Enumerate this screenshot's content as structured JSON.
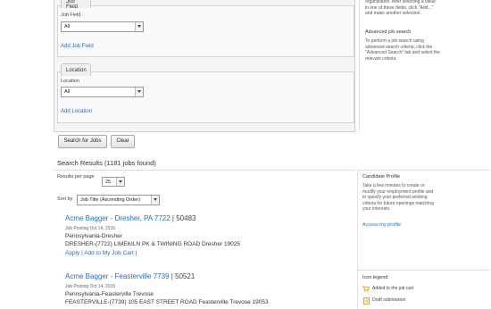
{
  "search_form": {
    "job_field_fieldset": {
      "legend": "Job Field",
      "field_label": "Job Field",
      "select_value": "All",
      "add_link": "Add Job Field"
    },
    "location_fieldset": {
      "legend": "Location",
      "field_label": "Location",
      "select_value": "All",
      "add_link": "Add Location"
    },
    "search_button": "Search for Jobs",
    "clear_button": "Clear"
  },
  "right_help": {
    "top_text": "organization. After selecting a value in one of these fields, click \"Add...\" and make another selection.",
    "advanced_heading": "Advanced job search",
    "advanced_text": "To perform a job search using advanced search criteria, click the \"Advanced Search\" tab and select the relevant criteria."
  },
  "results": {
    "heading": "Search Results (1181 jobs found)",
    "per_page_label": "Results per page",
    "per_page_value": "25",
    "sort_label": "Sort by",
    "sort_value": "Job Title (Ascending Order)",
    "jobs": [
      {
        "title": "Acme Bagger - Dresher, PA 7722",
        "sep": " | ",
        "number": "50483",
        "posting": "Job Posting Oct 14, 2016",
        "region": "Pennsylvania-Dresher",
        "address": "DRESHER-(7722) LIMEKILN PK & TWINING ROAD  Dresher 19025",
        "apply": "Apply",
        "action_sep": " | ",
        "add_cart": "Add to My Job Cart",
        "action_end": " |"
      },
      {
        "title": "Acme Bagger - Feasterville 7739",
        "sep": " | ",
        "number": "50521",
        "posting": "Job Posting Oct 14, 2016",
        "region": "Pennsylvania-Feasterville Trevose",
        "address": "FEASTERVILLE-(7739) 105 EAST STREET ROAD  Feasterville Trevose 19053",
        "apply": "",
        "action_sep": "",
        "add_cart": "",
        "action_end": ""
      }
    ]
  },
  "candidate_profile": {
    "heading": "Candidate Profile",
    "text": "Take a few minutes to create or modify your employment profile and to specify your preferred working criteria for future openings matching your interests.",
    "link": "Access my profile"
  },
  "icon_legend": {
    "heading": "Icon legend",
    "items": [
      {
        "icon": "cart-icon",
        "label": "Added to the job cart"
      },
      {
        "icon": "draft-icon",
        "label": "Draft submission"
      }
    ]
  },
  "colors": {
    "link": "#2b6cb8",
    "cart_icon": "#e0a73a",
    "draft_icon": "#d9a640"
  }
}
